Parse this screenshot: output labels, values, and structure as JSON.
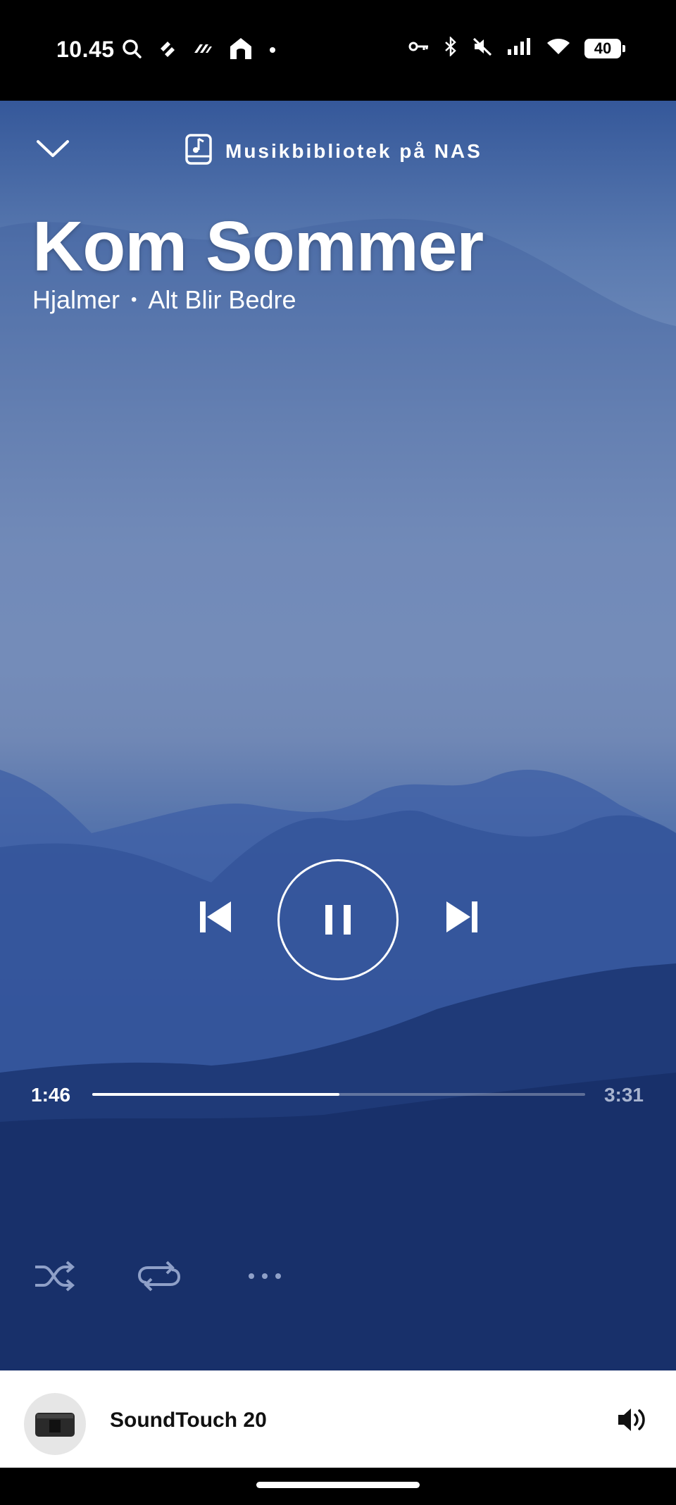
{
  "status_bar": {
    "time": "10.45",
    "battery": "40",
    "left_icons": [
      "search-icon",
      "sync-icon",
      "app-icon",
      "home-icon",
      "dot-icon"
    ],
    "right_icons": [
      "key-icon",
      "bluetooth-icon",
      "mute-icon",
      "signal-icon",
      "wifi-icon"
    ]
  },
  "header": {
    "source_label": "Musikbibliotek på NAS",
    "source_icon": "music-library-icon",
    "collapse_icon": "chevron-down-icon"
  },
  "track": {
    "title": "Kom Sommer",
    "artist": "Hjalmer",
    "separator": "•",
    "album": "Alt Blir Bedre"
  },
  "playback": {
    "state": "playing",
    "elapsed": "1:46",
    "duration": "3:31",
    "progress_fraction": 0.502
  },
  "device": {
    "name": "SoundTouch 20",
    "volume_icon": "volume-icon"
  },
  "colors": {
    "accent": "#ffffff",
    "device_bar_bg": "#ffffff",
    "sky_top": "#35589a",
    "sky_mid": "#93a7ca",
    "hills_dark": "#15295e"
  }
}
